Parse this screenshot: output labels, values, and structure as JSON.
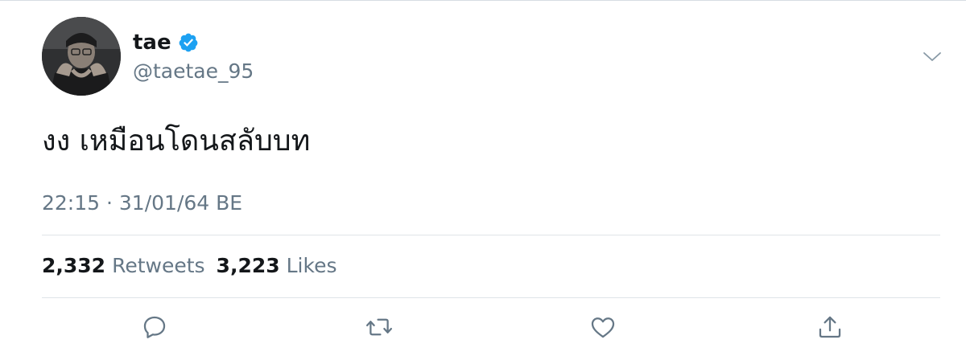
{
  "user": {
    "display_name": "tae",
    "handle": "@taetae_95",
    "verified": true
  },
  "tweet": {
    "text": "งง เหมือนโดนสลับบท",
    "time": "22:15",
    "separator": "·",
    "date": "31/01/64 BE"
  },
  "stats": {
    "retweets_count": "2,332",
    "retweets_label": "Retweets",
    "likes_count": "3,223",
    "likes_label": "Likes"
  },
  "icons": {
    "verified": "verified-badge-icon",
    "caret": "chevron-down-icon",
    "reply": "reply-icon",
    "retweet": "retweet-icon",
    "like": "heart-icon",
    "share": "share-icon"
  },
  "colors": {
    "verified_blue": "#1da1f2",
    "text_primary": "#14171a",
    "text_secondary": "#657786",
    "icon_gray": "#657786"
  }
}
